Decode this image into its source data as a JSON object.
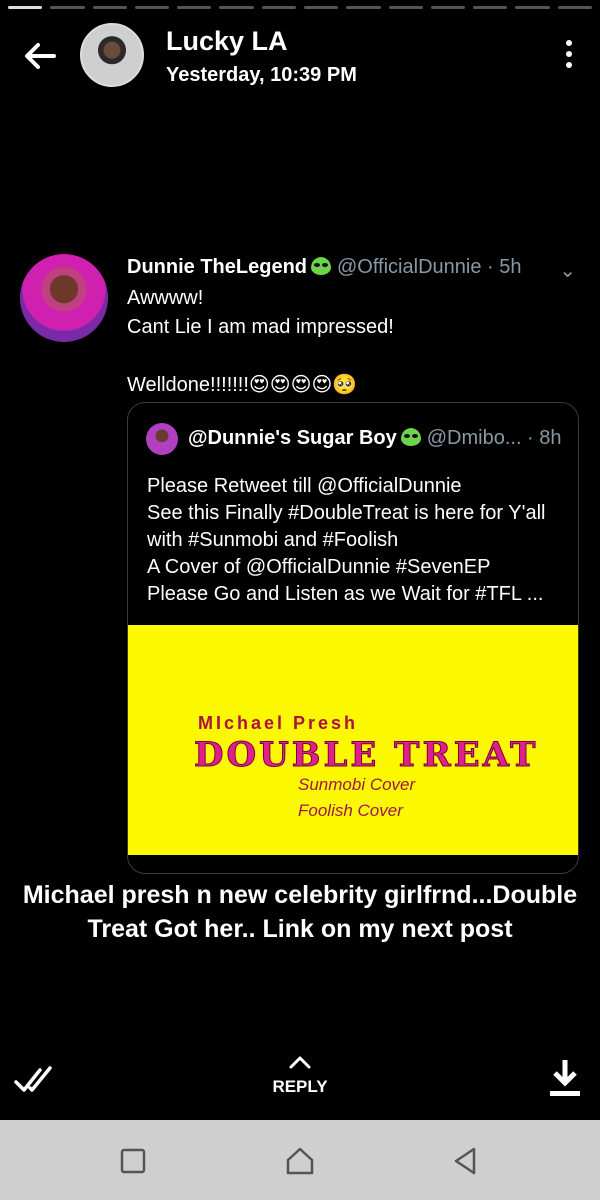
{
  "header": {
    "name": "Lucky LA",
    "time": "Yesterday, 10:39 PM"
  },
  "tweet": {
    "display_name": "Dunnie TheLegend",
    "handle_time": "@OfficialDunnie · 5h",
    "line1": "Awwww!",
    "line2": "Cant Lie I am mad impressed!",
    "line3": "Welldone!!!!!!!😍😍😍😍🥺",
    "quote": {
      "display_name": "@Dunnie's Sugar Boy",
      "handle_time": "@Dmibo... · 8h",
      "lines": [
        "Please Retweet till @OfficialDunnie",
        "See this Finally #DoubleTreat is here for Y'all",
        "with #Sunmobi and #Foolish",
        "A Cover of @OfficialDunnie #SevenEP",
        "Please Go and Listen as we Wait for #TFL ..."
      ],
      "image": {
        "artist": "MIchael Presh",
        "title": "DOUBLE TREAT",
        "sub1": "Sunmobi Cover",
        "sub2": "Foolish Cover",
        "background": "#fbf800"
      }
    }
  },
  "caption": "Michael presh n new celebrity girlfrnd...Double Treat Got her.. Link on my next post",
  "bottom": {
    "reply_label": "REPLY"
  },
  "colors": {
    "background": "#000000",
    "muted": "#8899a6",
    "navbar": "#cfcfcf"
  }
}
